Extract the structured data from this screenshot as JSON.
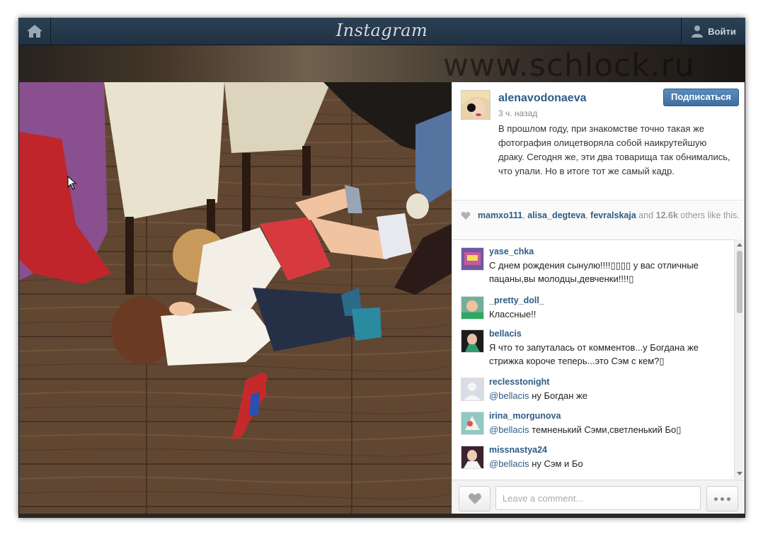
{
  "app": {
    "logo_text": "Instagram",
    "login_label": "Войти"
  },
  "watermark": "www.schlock.ru",
  "post": {
    "author": "alenavodonaeva",
    "time": "3 ч. назад",
    "follow_label": "Подписаться",
    "caption": "В прошлом году, при знакомстве точно такая же фотография олицетворяла собой наикрутейшую драку. Сегодня же, эти два товарища так обнимались, что упали. Но в итоге тот же самый кадр."
  },
  "likes": {
    "user1": "mamxo111",
    "user2": "alisa_degteva",
    "user3": "fevralskaja",
    "and_word": "and",
    "count": "12.6k",
    "suffix": "others like this."
  },
  "comments": [
    {
      "user": "yase_chka",
      "mention": "",
      "text": "С днем рождения сынулю!!!!▯▯▯▯ у вас отличные пацаны,вы молодцы,девченки!!!!▯"
    },
    {
      "user": "_pretty_doll_",
      "mention": "",
      "text": "Классные!!"
    },
    {
      "user": "bellacis",
      "mention": "",
      "text": "Я что то запуталась от комментов...у Богдана же стрижка короче теперь...это Сэм с кем?▯"
    },
    {
      "user": "reclesstonight",
      "mention": "@bellacis",
      "text": "ну Богдан же"
    },
    {
      "user": "irina_morgunova",
      "mention": "@bellacis",
      "text": "темненький Сэми,светленький Бо▯"
    },
    {
      "user": "missnastya24",
      "mention": "@bellacis",
      "text": "ну Сэм и Бо"
    }
  ],
  "compose": {
    "placeholder": "Leave a comment..."
  },
  "icons": {
    "home": "home-icon",
    "user": "user-icon",
    "heart": "heart-icon",
    "more": "more-dots-icon"
  },
  "colors": {
    "link": "#2f5c87",
    "topbar": "#203142",
    "follow": "#3f6f9f"
  }
}
